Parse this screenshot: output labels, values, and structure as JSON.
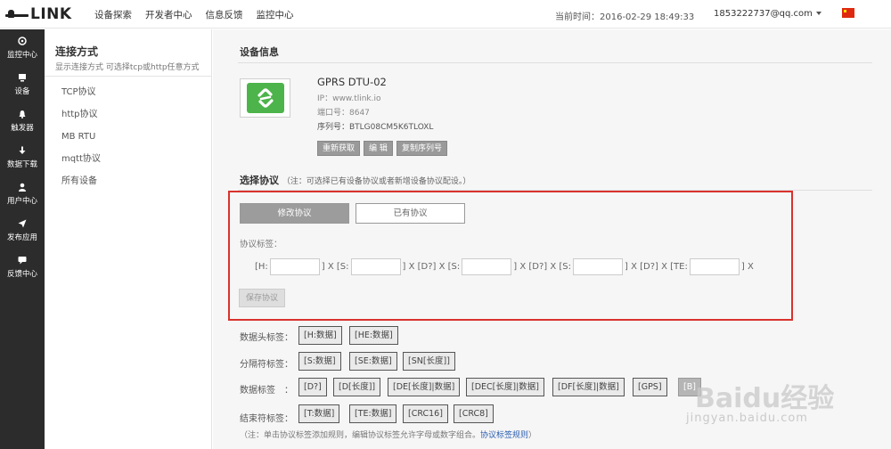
{
  "header": {
    "logo_text": "LINK",
    "nav": [
      "设备探索",
      "开发者中心",
      "信息反馈",
      "监控中心"
    ],
    "time": "当前时间：2016-02-29 18:49:33",
    "user": "1853222737@qq.com"
  },
  "sidebar": {
    "items": [
      {
        "label": "监控中心",
        "icon": "monitor-icon"
      },
      {
        "label": "设备",
        "icon": "device-icon"
      },
      {
        "label": "触发器",
        "icon": "bell-icon"
      },
      {
        "label": "数据下载",
        "icon": "download-icon"
      },
      {
        "label": "用户中心",
        "icon": "user-icon"
      },
      {
        "label": "发布应用",
        "icon": "send-icon"
      },
      {
        "label": "反馈中心",
        "icon": "chat-icon"
      }
    ]
  },
  "panel": {
    "title": "连接方式",
    "subtitle": "显示连接方式 可选择tcp或http任意方式",
    "items": [
      "TCP协议",
      "http协议",
      "MB RTU",
      "mqtt协议",
      "所有设备"
    ]
  },
  "device": {
    "section_title": "设备信息",
    "name": "GPRS DTU-02",
    "ip": "IP：www.tlink.io",
    "port": "端口号：8647",
    "serial": "序列号：BTLG08CM5K6TLOXL",
    "buttons": [
      "重新获取",
      "编 辑",
      "复制序列号"
    ]
  },
  "protocol": {
    "title": "选择协议",
    "note": "（注：可选择已有设备协议或者新增设备协议配设。）",
    "tab_modify": "修改协议",
    "tab_existing": "已有协议",
    "rule_label": "协议标签：",
    "tokens": [
      "[H:",
      "] X [S:",
      "] X [D?] X [S:",
      "] X [D?] X [S:",
      "] X [D?] X [TE:",
      "] X"
    ],
    "save": "保存协议"
  },
  "tags": {
    "head_label": "数据头标签：",
    "head": [
      "[H:数据]",
      "[HE:数据]"
    ],
    "sep_label": "分隔符标签：",
    "sep": [
      "[S:数据]",
      "[SE:数据]",
      "[SN[长度]]"
    ],
    "data_label": "数据标签　：",
    "data": [
      "[D?]",
      "[D[长度]]",
      "[DE[长度]|数据]",
      "[DEC[长度]|数据]",
      "[DF[长度]|数据]",
      "[GPS]"
    ],
    "data_extra": "[B]",
    "end_label": "结束符标签：",
    "end": [
      "[T:数据]",
      "[TE:数据]",
      "[CRC16]",
      "[CRC8]"
    ],
    "note": "（注：单击协议标签添加规则，编辑协议标签允许字母或数字组合。",
    "note_link": "协议标签规则",
    "note_end": "）"
  },
  "watermark": {
    "brand": "Baidu经验",
    "url": "jingyan.baidu.com"
  }
}
